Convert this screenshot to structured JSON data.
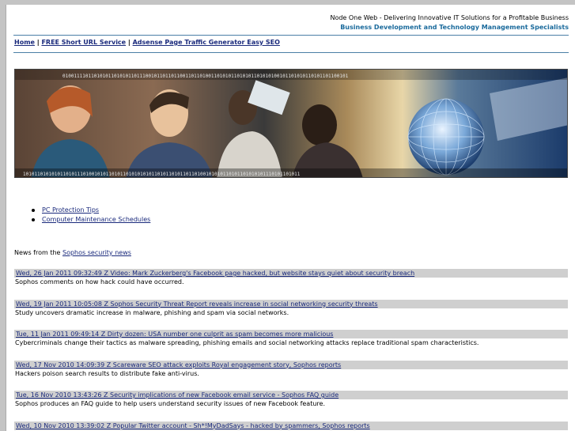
{
  "header": {
    "tagline_main": "Node One Web - Delivering Innovative IT Solutions for a Profitable Business",
    "tagline_sub": "Business Development and Technology Management Specialists"
  },
  "nav": {
    "home": "Home",
    "sep1": " | ",
    "short_url": "FREE Short URL Service",
    "sep2": " | ",
    "adsense": "Adsense Page Traffic Generator Easy SEO"
  },
  "banner": {
    "binary_top": "0100111101101010110101011011100101101101100110110100110101011010101101010100101101010110101101100101",
    "binary_bottom": "1010110101010110101110100101011010110101010101101011010110110100101010110101101010101110101101011"
  },
  "links": [
    {
      "label": "PC Protection Tips"
    },
    {
      "label": "Computer Maintenance Schedules"
    }
  ],
  "intro": {
    "prefix": "News from the ",
    "link": "Sophos security news"
  },
  "news": [
    {
      "title": "Wed, 26 Jan 2011 09:32:49 Z Video: Mark Zuckerberg's Facebook page hacked, but website stays quiet about security breach",
      "desc": "Sophos comments on how hack could have occurred."
    },
    {
      "title": "Wed, 19 Jan 2011 10:05:08 Z Sophos Security Threat Report reveals increase in social networking security threats",
      "desc": "Study uncovers dramatic increase in malware, phishing and spam via social networks."
    },
    {
      "title": "Tue, 11 Jan 2011 09:49:14 Z Dirty dozen: USA number one culprit as spam becomes more malicious",
      "desc": "Cybercriminals change their tactics as malware spreading, phishing emails and social networking attacks replace traditional spam characteristics."
    },
    {
      "title": "Wed, 17 Nov 2010 14:09:39 Z Scareware SEO attack exploits Royal engagement story, Sophos reports",
      "desc": "Hackers poison search results to distribute fake anti-virus."
    },
    {
      "title": "Tue, 16 Nov 2010 13:43:26 Z Security implications of new Facebook email service - Sophos FAQ guide",
      "desc": "Sophos produces an FAQ guide to help users understand security issues of new Facebook feature."
    },
    {
      "title": "Wed, 10 Nov 2010 13:39:02 Z Popular Twitter account - Sh*!MyDadSays - hacked by spammers, Sophos reports",
      "desc": ""
    }
  ]
}
